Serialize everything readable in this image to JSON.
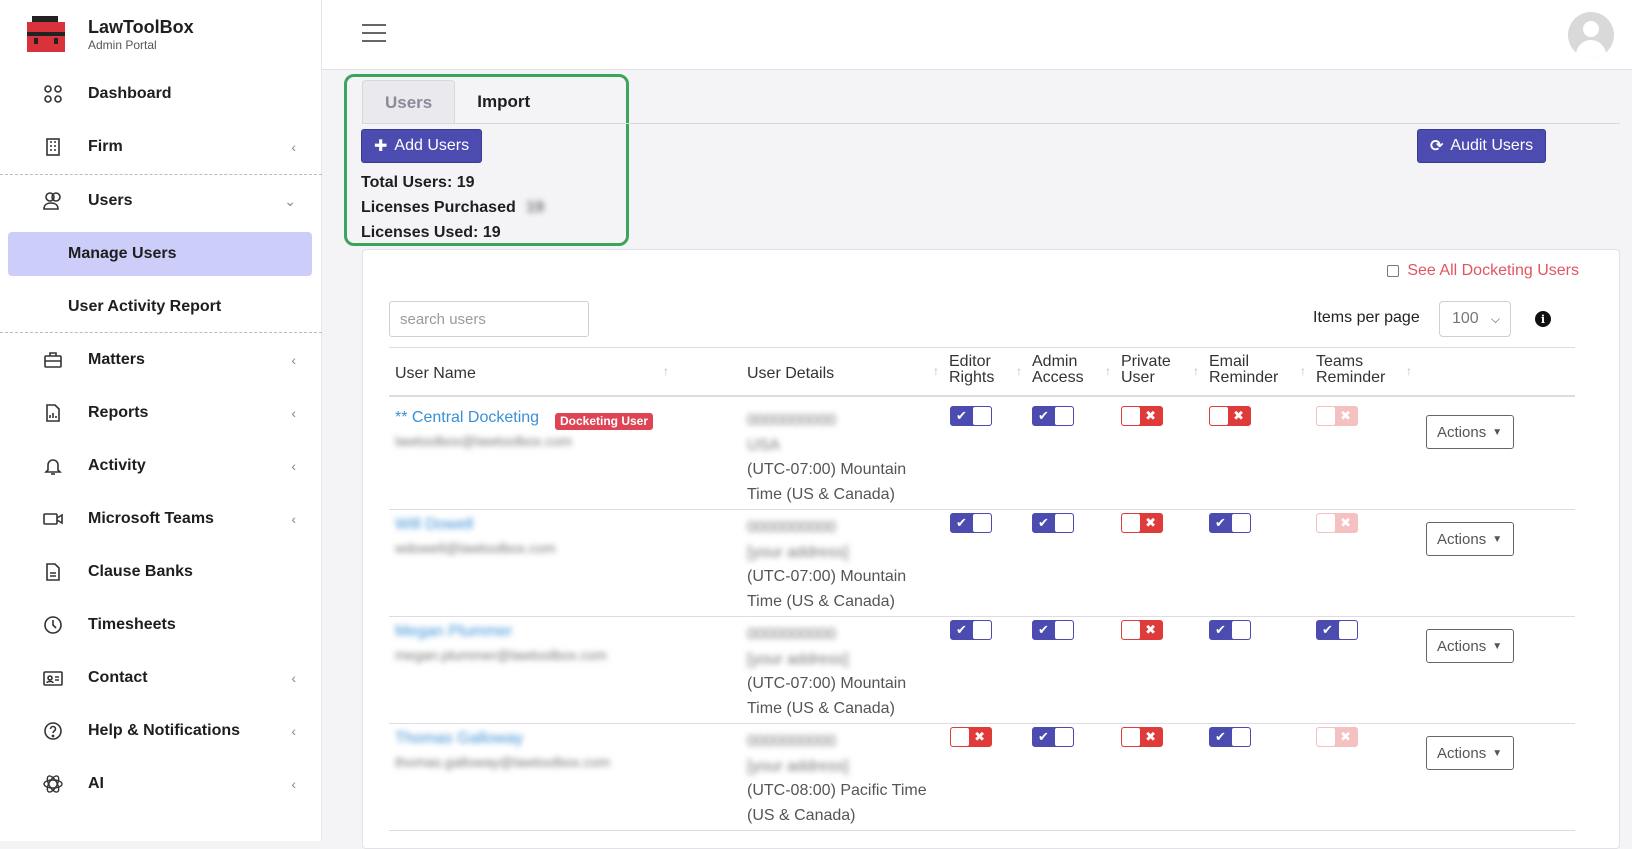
{
  "brand": {
    "title": "LawToolBox",
    "subtitle": "Admin Portal"
  },
  "sidebar": {
    "items": [
      {
        "label": "Dashboard",
        "icon": "dashboard-icon",
        "chevron": ""
      },
      {
        "label": "Firm",
        "icon": "building-icon",
        "chevron": "‹"
      },
      {
        "label": "Users",
        "icon": "users-icon",
        "chevron": "⌄"
      },
      {
        "label": "Matters",
        "icon": "briefcase-icon",
        "chevron": "‹"
      },
      {
        "label": "Reports",
        "icon": "report-icon",
        "chevron": "‹"
      },
      {
        "label": "Activity",
        "icon": "bell-icon",
        "chevron": "‹"
      },
      {
        "label": "Microsoft Teams",
        "icon": "video-icon",
        "chevron": "‹"
      },
      {
        "label": "Clause Banks",
        "icon": "document-icon",
        "chevron": ""
      },
      {
        "label": "Timesheets",
        "icon": "clock-icon",
        "chevron": ""
      },
      {
        "label": "Contact",
        "icon": "contact-card-icon",
        "chevron": "‹"
      },
      {
        "label": "Help & Notifications",
        "icon": "help-icon",
        "chevron": "‹"
      },
      {
        "label": "AI",
        "icon": "ai-icon",
        "chevron": "‹"
      }
    ],
    "subitems": [
      {
        "label": "Manage Users",
        "active": true
      },
      {
        "label": "User Activity Report",
        "active": false
      }
    ]
  },
  "tabs": [
    {
      "label": "Users",
      "active": true
    },
    {
      "label": "Import",
      "active": false
    }
  ],
  "buttons": {
    "add_users": "Add Users",
    "audit_users": "Audit Users"
  },
  "stats": {
    "total_users": "Total Users: 19",
    "licenses_purchased": "Licenses Purchased",
    "licenses_purchased_value": "19",
    "licenses_used": "Licenses Used: 19"
  },
  "filters": {
    "see_all_docketing": "See All Docketing Users",
    "search_placeholder": "search users",
    "items_per_page_label": "Items per page",
    "items_per_page_value": "100"
  },
  "table": {
    "columns": {
      "user_name": "User Name",
      "user_details": "User Details",
      "editor_rights": [
        "Editor",
        "Rights"
      ],
      "admin_access": [
        "Admin",
        "Access"
      ],
      "private_user": [
        "Private",
        "User"
      ],
      "email_reminder": [
        "Email",
        "Reminder"
      ],
      "teams_reminder": [
        "Teams",
        "Reminder"
      ]
    },
    "actions_label": "Actions",
    "rows": [
      {
        "name": "** Central Docketing",
        "badge": "Docketing User",
        "email": "lawtoolbox@lawtoolbox.com",
        "phone": "0000000000",
        "address": "USA",
        "tz1": "(UTC-07:00) Mountain",
        "tz2": "Time (US & Canada)",
        "editor": true,
        "admin": true,
        "private": false,
        "email_rem": false,
        "teams": false,
        "name_blurred": false,
        "address_blurred": true
      },
      {
        "name": "Will Dowell",
        "badge": "",
        "email": "wdowell@lawtoolbox.com",
        "phone": "0000000000",
        "address": "[your address]",
        "tz1": "(UTC-07:00) Mountain",
        "tz2": "Time (US & Canada)",
        "editor": true,
        "admin": true,
        "private": false,
        "email_rem": true,
        "teams": false,
        "name_blurred": true,
        "address_blurred": true
      },
      {
        "name": "Megan Plummer",
        "badge": "",
        "email": "megan.plummer@lawtoolbox.com",
        "phone": "0000000000",
        "address": "[your address]",
        "tz1": "(UTC-07:00) Mountain",
        "tz2": "Time (US & Canada)",
        "editor": true,
        "admin": true,
        "private": false,
        "email_rem": true,
        "teams": true,
        "name_blurred": true,
        "address_blurred": true
      },
      {
        "name": "Thomas Galloway",
        "badge": "",
        "email": "thomas.galloway@lawtoolbox.com",
        "phone": "0000000000",
        "address": "[your address]",
        "tz1": "(UTC-08:00) Pacific Time",
        "tz2": "(US & Canada)",
        "editor": false,
        "admin": true,
        "private": false,
        "email_rem": true,
        "teams": false,
        "name_blurred": true,
        "address_blurred": true
      }
    ]
  },
  "colors": {
    "primary": "#4b4bb0",
    "danger": "#df3b3b",
    "link": "#3b8fd6",
    "highlight_border": "#3ca45b",
    "active_nav": "#cdcdfa"
  }
}
